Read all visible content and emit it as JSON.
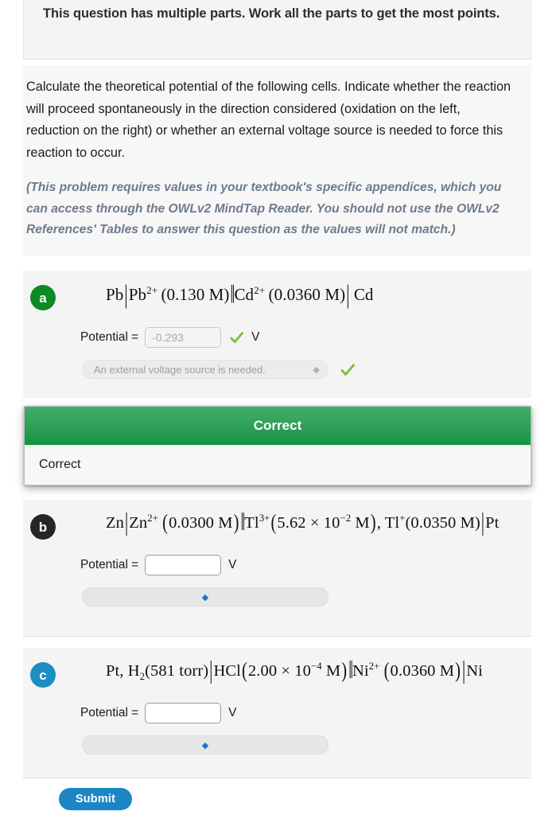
{
  "notice": {
    "text": "This question has multiple parts. Work all the parts to get the most points."
  },
  "intro": {
    "paragraph": "Calculate the theoretical potential of the following cells. Indicate whether the reaction will proceed spontaneously in the direction considered (oxidation on the left, reduction on the right) or whether an external voltage source is needed to force this reaction to occur.",
    "note": "(This problem requires values in your textbook's specific appendices, which you can access through the OWLv2 MindTap Reader. You should not use the OWLv2 References' Tables to answer this question as the values will not match.)"
  },
  "parts": {
    "a": {
      "badge": "a",
      "badge_color": "#0c8a25",
      "equation_plain": "Pb|Pb2+ (0.130 M)||Cd2+ (0.0360 M)|Cd",
      "eq": {
        "e1": "Pb",
        "e2": "Pb",
        "e2sup": "2+",
        "e3": "(0.130  M)",
        "e4": "Cd",
        "e4sup": "2+",
        "e5": "(0.0360 M)",
        "e6": "Cd"
      },
      "potential_label": "Potential =",
      "potential_value": "-0.293",
      "unit": "V",
      "select_value": "An external voltage source is needed.",
      "status_icon": "green-check-icon"
    },
    "b": {
      "badge": "b",
      "badge_color": "#262626",
      "equation_plain": "Zn|Zn2+ (0.0300 M)||Tl3+ (5.62 x 10-2 M), Tl+ (0.0350 M)|Pt",
      "eq": {
        "e1": "Zn",
        "e2": "Zn",
        "e2sup": "2+",
        "e3": "0.0300  M",
        "e4": "Tl",
        "e4sup": "3+",
        "e5a": "5.62 × 10",
        "e5sup": "−2",
        "e5b": " M",
        "e6": "Tl",
        "e6sup": "+",
        "e7": "(0.0350 M)",
        "e8": "Pt"
      },
      "potential_label": "Potential =",
      "potential_value": "",
      "unit": "V",
      "select_value": ""
    },
    "c": {
      "badge": "c",
      "badge_color": "#1b8ec2",
      "equation_plain": "Pt, H2 (581 torr)|HCl(2.00 x 10-4 M)||Ni2+ (0.0360 M)|Ni",
      "eq": {
        "e1": "Pt, H",
        "e1sub": "2",
        "e2": "(581  torr)",
        "e3": "HCl",
        "e4a": "2.00 × 10",
        "e4sup": "−4",
        "e4b": " M",
        "e5": "Ni",
        "e5sup": "2+",
        "e6": "0.0360  M",
        "e7": "Ni"
      },
      "potential_label": "Potential =",
      "potential_value": "",
      "unit": "V",
      "select_value": ""
    }
  },
  "feedback": {
    "header": "Correct",
    "body": "Correct"
  },
  "submit": {
    "label": "Submit"
  }
}
